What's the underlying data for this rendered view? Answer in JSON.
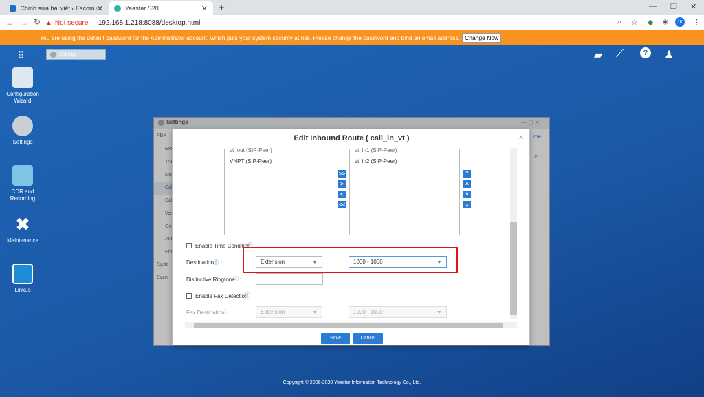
{
  "browser": {
    "tabs": [
      {
        "title": "Chỉnh sửa bài viết ‹ Escom Co., Lt"
      },
      {
        "title": "Yeastar S20"
      }
    ],
    "address": {
      "security": "Not secure",
      "url": "192.168.1.218:8088/desktop.html"
    },
    "avatar_initials": "JK"
  },
  "banner": {
    "message": "You are using the default password for the Administrator account, which puts your system security at risk. Please change the password and bind an email address.",
    "action": "Change Now"
  },
  "taskbar": {
    "settings_label": "Settings"
  },
  "desktop_icons": [
    {
      "label": "Configuration Wizard"
    },
    {
      "label": "Settings"
    },
    {
      "label": "CDR and Recording"
    },
    {
      "label": "Maintenance"
    },
    {
      "label": "Linkus"
    }
  ],
  "settings_window": {
    "title": "Settings",
    "nav": [
      "PBX",
      "Ext",
      "Tru",
      "Mul",
      "Cal",
      "Cal",
      "Voi",
      "Gen",
      "Aut",
      "Em",
      "Syste",
      "Even"
    ],
    "right_fragment": "me"
  },
  "dialog": {
    "title": "Edit Inbound Route ( call_in_vt )",
    "left_list": [
      "vt_out (SIP-Peer)",
      "VNPT (SIP-Peer)"
    ],
    "right_list": [
      "vt_in1 (SIP-Peer)",
      "vt_in2 (SIP-Peer)"
    ],
    "move_buttons": [
      ">>",
      ">",
      "<",
      "<<"
    ],
    "order_buttons": [
      "top",
      "up",
      "down",
      "bottom"
    ],
    "enable_time_condition": "Enable Time Condition",
    "destination_label": "Destination",
    "destination_type": "Extension",
    "destination_value": "1000 - 1000",
    "distinctive_ringtone_label": "Distinctive Ringtone",
    "enable_fax_detection": "Enable Fax Detection",
    "fax_destination_label": "Fax Destination",
    "fax_type": "Extension",
    "fax_value": "1000 - 1000",
    "save": "Save",
    "cancel": "Cancel"
  },
  "footer": {
    "copyright": "Copyright © 2006-2020 Yeastar Information Technology Co., Ltd."
  },
  "colors": {
    "banner": "#f7931e",
    "accent": "#2a7bd3",
    "highlight": "#e0121a"
  }
}
